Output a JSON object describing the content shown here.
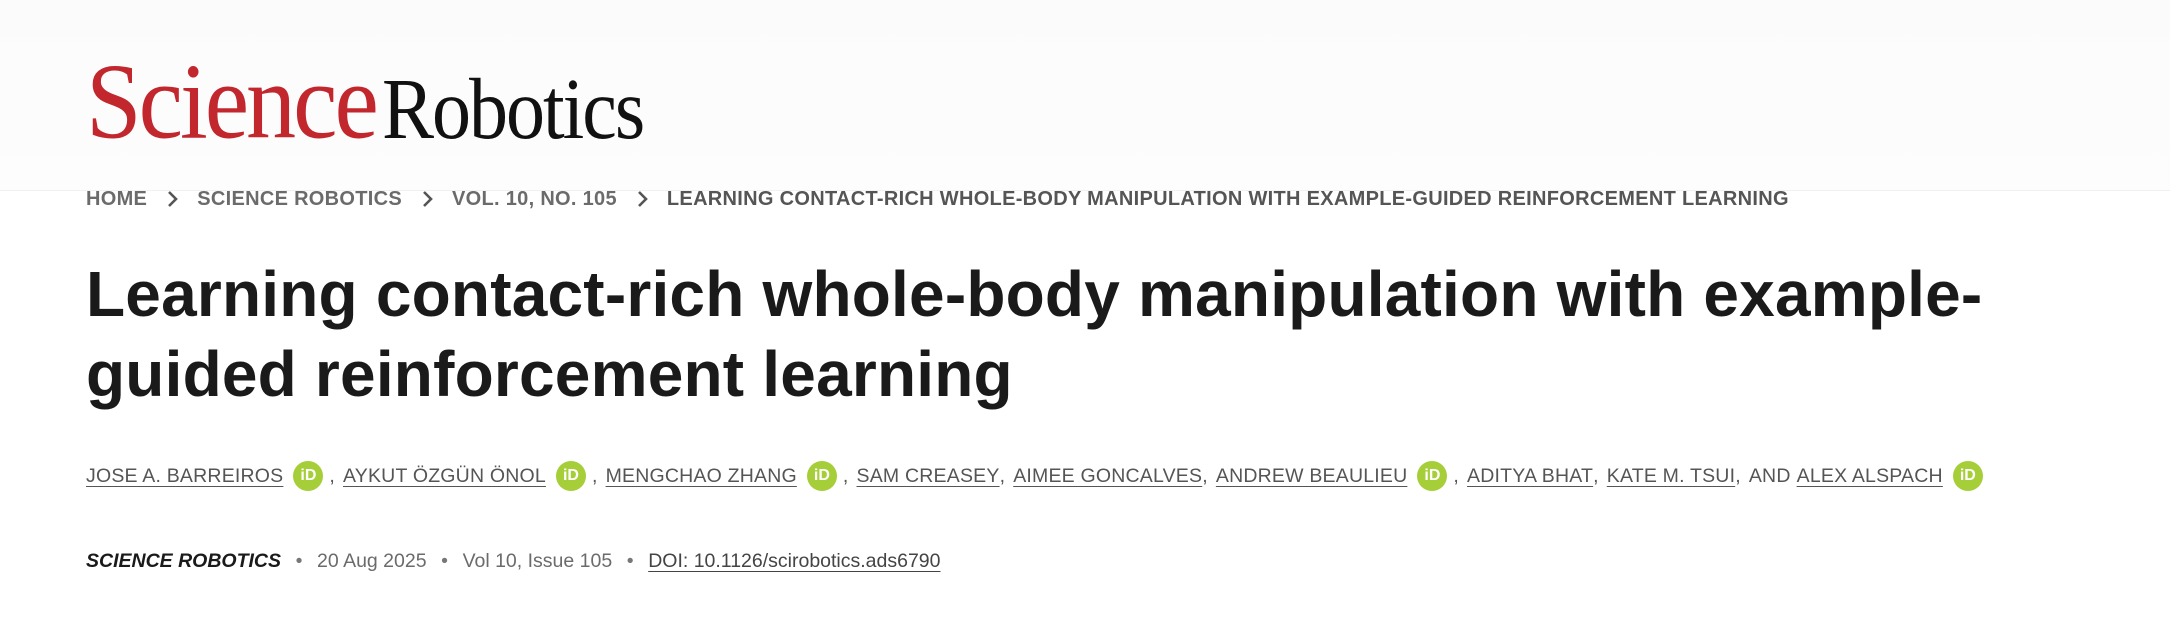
{
  "logo": {
    "part1": "Science",
    "part2": "Robotics",
    "colors": {
      "science": "#c1272d",
      "robotics": "#111111"
    }
  },
  "breadcrumb": {
    "items": [
      "HOME",
      "SCIENCE ROBOTICS",
      "VOL. 10, NO. 105",
      "LEARNING CONTACT-RICH WHOLE-BODY MANIPULATION WITH EXAMPLE-GUIDED REINFORCEMENT LEARNING"
    ],
    "separator_icon": "chevron-right-icon"
  },
  "article": {
    "title": "Learning contact-rich whole-body manipulation with example-guided reinforcement learning"
  },
  "authors": {
    "list": [
      {
        "name": "JOSE A. BARREIROS",
        "orcid": true
      },
      {
        "name": "AYKUT ÖZGÜN ÖNOL",
        "orcid": true
      },
      {
        "name": "MENGCHAO ZHANG",
        "orcid": true
      },
      {
        "name": "SAM CREASEY",
        "orcid": false
      },
      {
        "name": "AIMEE GONCALVES",
        "orcid": false
      },
      {
        "name": "ANDREW BEAULIEU",
        "orcid": true
      },
      {
        "name": "ADITYA BHAT",
        "orcid": false
      },
      {
        "name": "KATE M. TSUI",
        "orcid": false
      },
      {
        "name": "ALEX ALSPACH",
        "orcid": true
      }
    ],
    "orcid_label": "iD",
    "orcid_color": "#a6ce39",
    "comma": ",",
    "and_label": "AND"
  },
  "meta": {
    "journal": "SCIENCE ROBOTICS",
    "bullet": "•",
    "date": "20 Aug 2025",
    "volume_issue": "Vol 10, Issue 105",
    "doi": "DOI: 10.1126/scirobotics.ads6790"
  }
}
